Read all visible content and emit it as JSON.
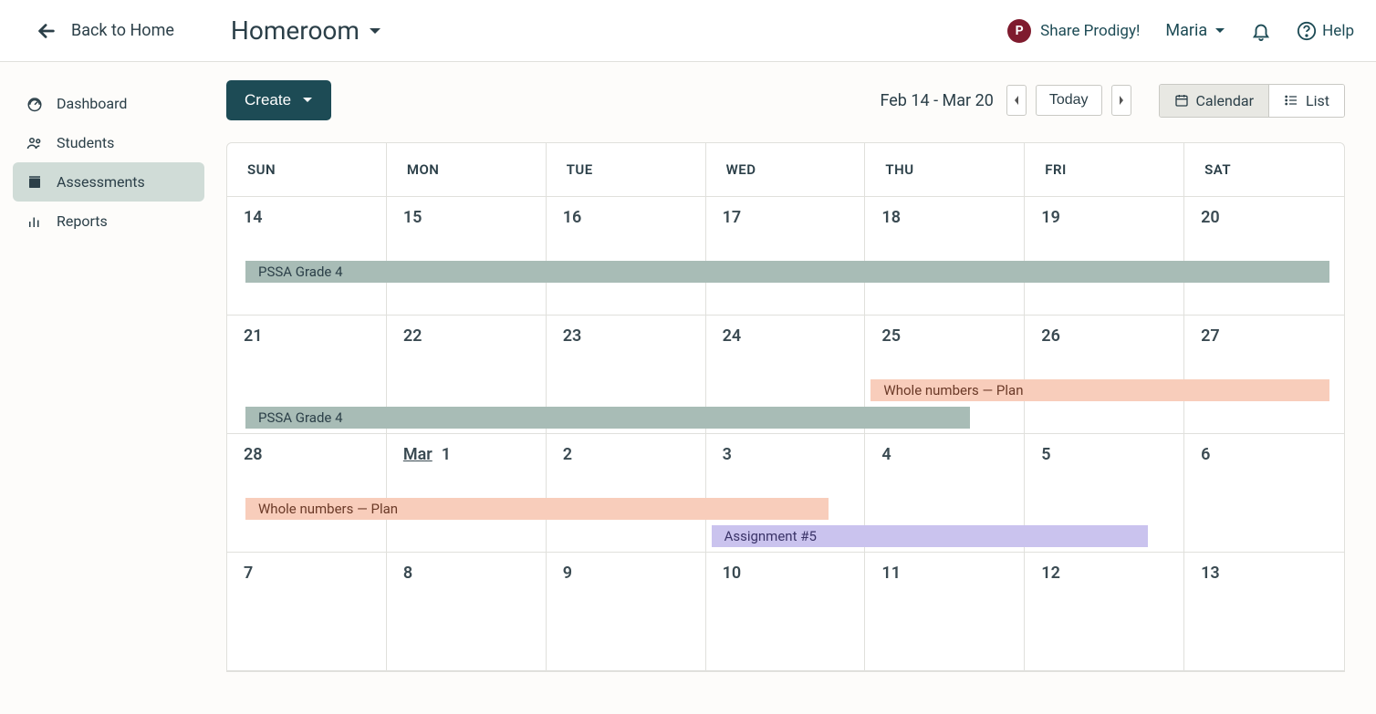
{
  "header": {
    "back_label": "Back to Home",
    "class_name": "Homeroom",
    "share_label": "Share Prodigy!",
    "user_name": "Maria",
    "help_label": "Help"
  },
  "sidebar": {
    "items": [
      {
        "label": "Dashboard",
        "icon": "dashboard"
      },
      {
        "label": "Students",
        "icon": "students"
      },
      {
        "label": "Assessments",
        "icon": "assessments",
        "active": true
      },
      {
        "label": "Reports",
        "icon": "reports"
      }
    ]
  },
  "toolbar": {
    "create_label": "Create",
    "date_range": "Feb 14 - Mar 20",
    "today_label": "Today",
    "calendar_label": "Calendar",
    "list_label": "List"
  },
  "calendar": {
    "day_headers": [
      "SUN",
      "MON",
      "TUE",
      "WED",
      "THU",
      "FRI",
      "SAT"
    ],
    "weeks": [
      [
        {
          "num": "14"
        },
        {
          "num": "15"
        },
        {
          "num": "16"
        },
        {
          "num": "17"
        },
        {
          "num": "18"
        },
        {
          "num": "19"
        },
        {
          "num": "20"
        }
      ],
      [
        {
          "num": "21"
        },
        {
          "num": "22"
        },
        {
          "num": "23"
        },
        {
          "num": "24"
        },
        {
          "num": "25"
        },
        {
          "num": "26"
        },
        {
          "num": "27"
        }
      ],
      [
        {
          "num": "28"
        },
        {
          "month": "Mar",
          "num": "1"
        },
        {
          "num": "2"
        },
        {
          "num": "3"
        },
        {
          "num": "4"
        },
        {
          "num": "5"
        },
        {
          "num": "6"
        }
      ],
      [
        {
          "num": "7"
        },
        {
          "num": "8"
        },
        {
          "num": "9"
        },
        {
          "num": "10"
        },
        {
          "num": "11"
        },
        {
          "num": "12"
        },
        {
          "num": "13"
        }
      ]
    ],
    "events": [
      {
        "label": "PSSA Grade 4",
        "color": "green",
        "row": 0,
        "startCol": 0,
        "endCol": 7,
        "track": 0,
        "arrowLeft": false,
        "arrowRight": true,
        "indentLeft": 20
      },
      {
        "label": "PSSA Grade 4",
        "color": "green",
        "row": 1,
        "startCol": 0,
        "endCol": 5,
        "track": 1,
        "arrowLeft": true,
        "arrowRight": false,
        "indentLeft": 20,
        "endOffset": -60
      },
      {
        "label": "Whole numbers — Plan",
        "color": "peach",
        "row": 1,
        "startCol": 4,
        "endCol": 7,
        "track": 0,
        "arrowLeft": false,
        "arrowRight": true,
        "indentLeft": 6
      },
      {
        "label": "Whole numbers — Plan",
        "color": "peach",
        "row": 2,
        "startCol": 0,
        "endCol": 4,
        "track": 0,
        "arrowLeft": true,
        "arrowRight": false,
        "indentLeft": 20,
        "endOffset": -40
      },
      {
        "label": "Assignment #5",
        "color": "purple",
        "row": 2,
        "startCol": 3,
        "endCol": 6,
        "track": 1,
        "arrowLeft": false,
        "arrowRight": false,
        "indentLeft": 6,
        "endOffset": -40
      }
    ]
  }
}
